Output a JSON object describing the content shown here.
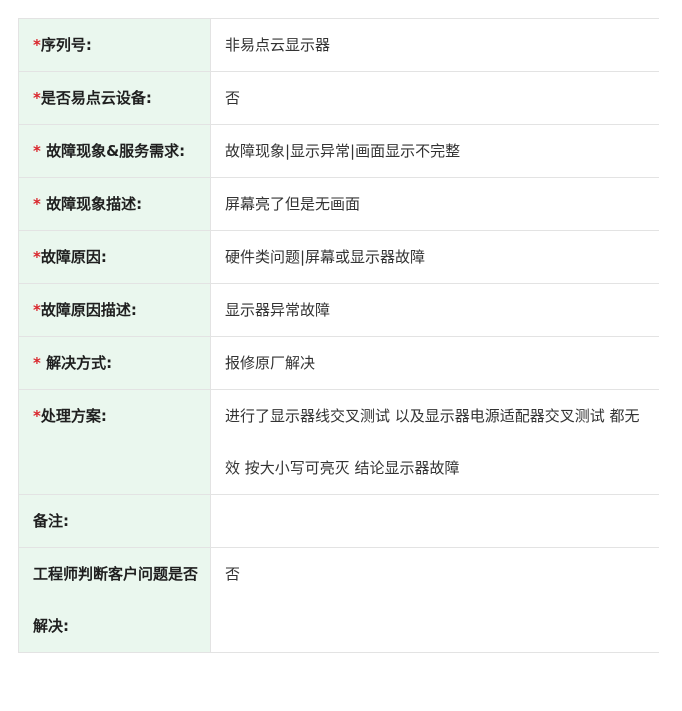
{
  "colors": {
    "label_bg": "#eaf7ee",
    "required_mark": "#d9252b",
    "border": "#e3e3e3"
  },
  "rows": [
    {
      "star": "*",
      "label": "序列号:",
      "value": "非易点云显示器"
    },
    {
      "star": "*",
      "label": "是否易点云设备:",
      "value": "否"
    },
    {
      "star": "*",
      "label": " 故障现象&服务需求:",
      "value": "故障现象|显示异常|画面显示不完整"
    },
    {
      "star": "*",
      "label": " 故障现象描述:",
      "value": "屏幕亮了但是无画面"
    },
    {
      "star": "*",
      "label": "故障原因:",
      "value": "硬件类问题|屏幕或显示器故障"
    },
    {
      "star": "*",
      "label": "故障原因描述:",
      "value": "显示器异常故障"
    },
    {
      "star": "*",
      "label": " 解决方式:",
      "value": "报修原厂解决"
    },
    {
      "star": "*",
      "label": "处理方案:",
      "value": "进行了显示器线交叉测试 以及显示器电源适配器交叉测试 都无效 按大小写可亮灭 结论显示器故障"
    },
    {
      "star": "",
      "label": "备注:",
      "value": ""
    },
    {
      "star": "",
      "label": "工程师判断客户问题是否解决:",
      "value": "否"
    }
  ]
}
